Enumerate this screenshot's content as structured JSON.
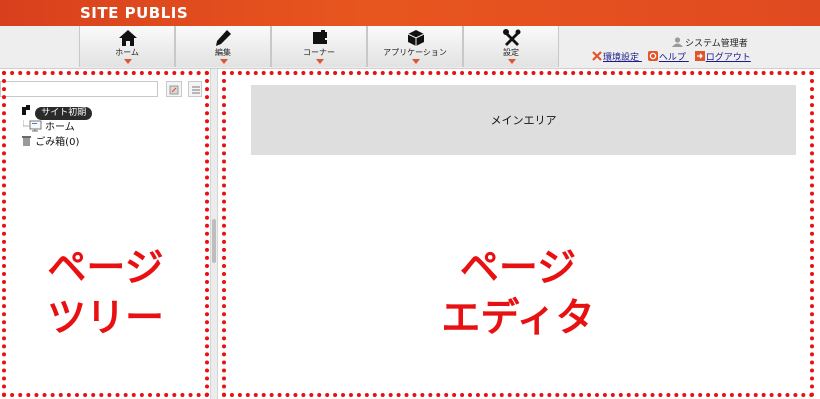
{
  "app": {
    "brand": "SITE PUBLIS"
  },
  "menu": [
    {
      "label": "ホーム",
      "icon": "home-icon"
    },
    {
      "label": "編集",
      "icon": "pencil-icon"
    },
    {
      "label": "コーナー",
      "icon": "puzzle-icon"
    },
    {
      "label": "アプリケーション",
      "icon": "cube-icon"
    },
    {
      "label": "設定",
      "icon": "tools-icon"
    }
  ],
  "user": {
    "name": "システム管理者",
    "links": [
      {
        "label": "環境設定",
        "icon": "wrench-icon"
      },
      {
        "label": "ヘルプ",
        "icon": "help-icon"
      },
      {
        "label": "ログアウト",
        "icon": "logout-icon"
      }
    ]
  },
  "tree": {
    "root": "サイト初期",
    "home": "ホーム",
    "trash": "ごみ箱(0)"
  },
  "main": {
    "banner": "メインエリア"
  },
  "annotations": {
    "left_line1": "ページ",
    "left_line2": "ツリー",
    "right_line1": "ページ",
    "right_line2": "エディタ",
    "color": "#e81010"
  }
}
